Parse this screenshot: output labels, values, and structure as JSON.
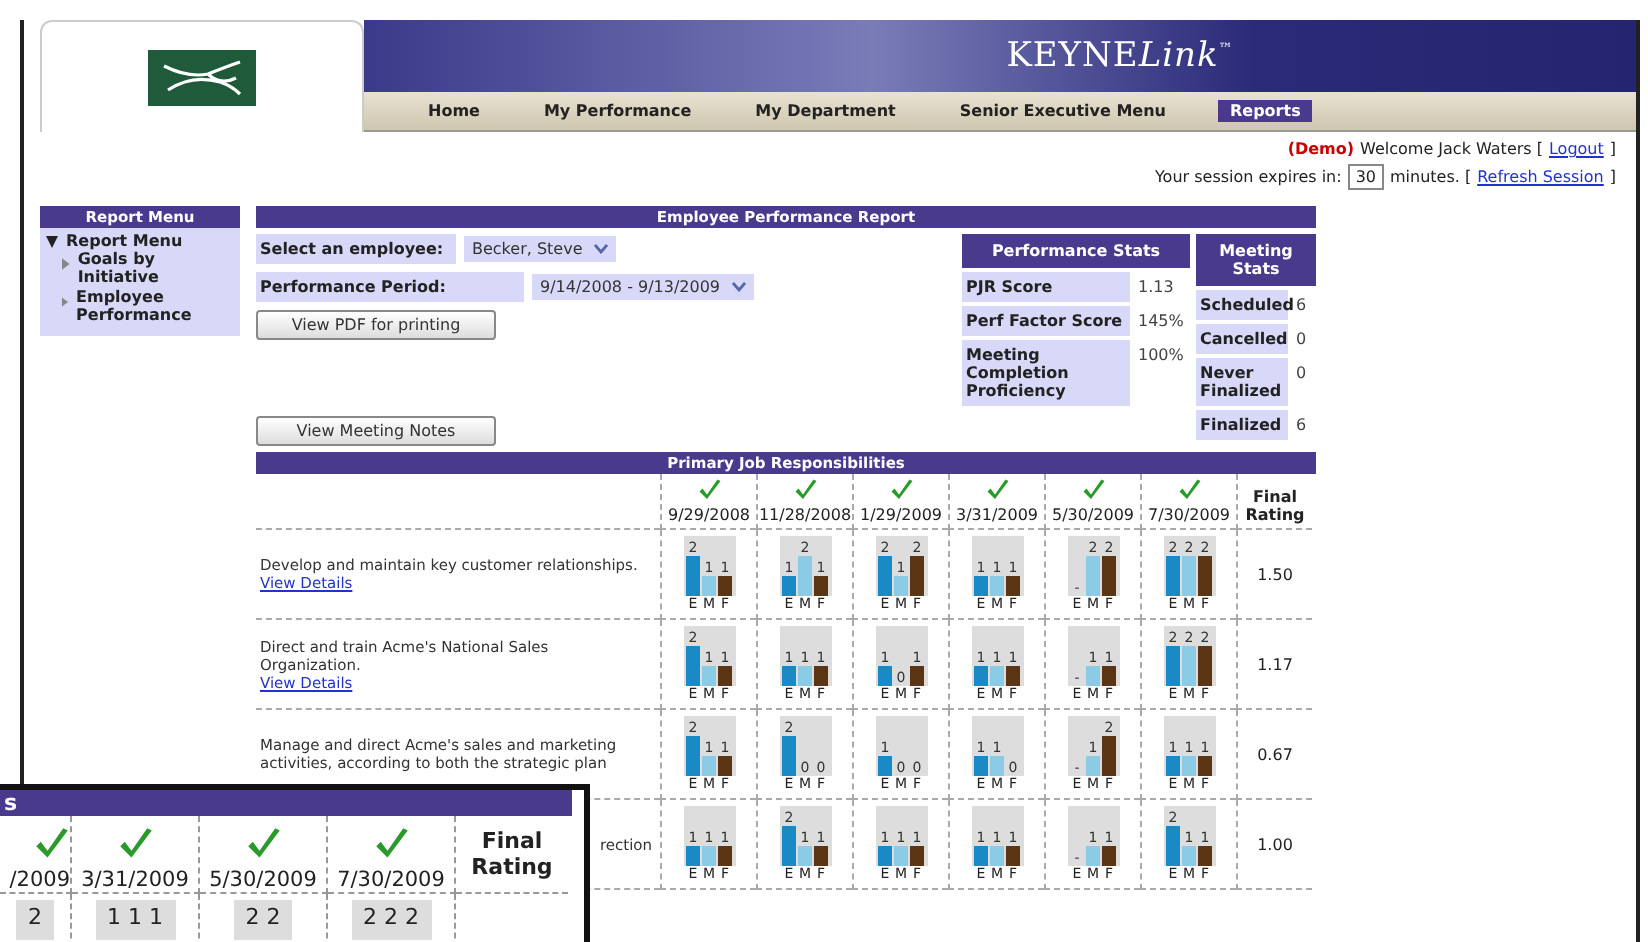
{
  "brand": {
    "name": "KEYNE",
    "italic": "Link",
    "mark": "™"
  },
  "nav": [
    {
      "label": "Home",
      "selected": false
    },
    {
      "label": "My Performance",
      "selected": false
    },
    {
      "label": "My Department",
      "selected": false
    },
    {
      "label": "Senior Executive Menu",
      "selected": false
    },
    {
      "label": "Reports",
      "selected": true
    }
  ],
  "user_bar": {
    "demo": "(Demo)",
    "welcome": "Welcome Jack Waters [",
    "logout": "Logout",
    "logout_close": "]",
    "session_label": "Your session expires in:",
    "session_minutes": "30",
    "session_suffix": "minutes. [",
    "refresh": "Refresh Session",
    "refresh_close": "]"
  },
  "report_menu": {
    "title": "Report Menu",
    "root": {
      "label": "Report Menu",
      "expanded": true,
      "children": [
        {
          "label": "Goals by Initiative"
        },
        {
          "label": "Employee Performance"
        }
      ]
    }
  },
  "report": {
    "title": "Employee Performance Report",
    "employee_label": "Select an employee:",
    "employee_value": "Becker, Steve",
    "period_label": "Performance Period:",
    "period_value": "9/14/2008 - 9/13/2009",
    "pdf_button": "View PDF for printing",
    "notes_button": "View Meeting Notes"
  },
  "performance_stats": {
    "title": "Performance Stats",
    "rows": [
      {
        "label": "PJR Score",
        "value": "1.13"
      },
      {
        "label": "Perf Factor Score",
        "value": "145%"
      },
      {
        "label": "Meeting Completion Proficiency",
        "value": "100%"
      }
    ]
  },
  "meeting_stats": {
    "title": "Meeting Stats",
    "rows": [
      {
        "label": "Scheduled",
        "value": "6"
      },
      {
        "label": "Cancelled",
        "value": "0"
      },
      {
        "label": "Never Finalized",
        "value": "0"
      },
      {
        "label": "Finalized",
        "value": "6"
      }
    ]
  },
  "responsibilities": {
    "title": "Primary Job Responsibilities",
    "final_header": "Final Rating",
    "columns": [
      {
        "date": "9/29/2008",
        "checked": true
      },
      {
        "date": "11/28/2008",
        "checked": true
      },
      {
        "date": "1/29/2009",
        "checked": true
      },
      {
        "date": "3/31/2009",
        "checked": true
      },
      {
        "date": "5/30/2009",
        "checked": true
      },
      {
        "date": "7/30/2009",
        "checked": true
      }
    ],
    "rows": [
      {
        "kind": "full",
        "text": "Develop and maintain key customer relationships.",
        "link": "View Details",
        "rating": "1.50",
        "cells": [
          [
            [
              "E",
              "2"
            ],
            [
              "M",
              "1"
            ],
            [
              "F",
              "1"
            ]
          ],
          [
            [
              "E",
              "1"
            ],
            [
              "M",
              "2"
            ],
            [
              "F",
              "1"
            ]
          ],
          [
            [
              "E",
              "2"
            ],
            [
              "M",
              "1"
            ],
            [
              "F",
              "2"
            ]
          ],
          [
            [
              "E",
              "1"
            ],
            [
              "M",
              "1"
            ],
            [
              "F",
              "1"
            ]
          ],
          [
            [
              "E",
              "-"
            ],
            [
              "M",
              "2"
            ],
            [
              "F",
              "2"
            ]
          ],
          [
            [
              "E",
              "2"
            ],
            [
              "M",
              "2"
            ],
            [
              "F",
              "2"
            ]
          ]
        ]
      },
      {
        "kind": "full",
        "text": "Direct and train Acme's National Sales Organization.",
        "link": "View Details",
        "rating": "1.17",
        "cells": [
          [
            [
              "E",
              "2"
            ],
            [
              "M",
              "1"
            ],
            [
              "F",
              "1"
            ]
          ],
          [
            [
              "E",
              "1"
            ],
            [
              "M",
              "1"
            ],
            [
              "F",
              "1"
            ]
          ],
          [
            [
              "E",
              "1"
            ],
            [
              "M",
              "0"
            ],
            [
              "F",
              "1"
            ]
          ],
          [
            [
              "E",
              "1"
            ],
            [
              "M",
              "1"
            ],
            [
              "F",
              "1"
            ]
          ],
          [
            [
              "E",
              "-"
            ],
            [
              "M",
              "1"
            ],
            [
              "F",
              "1"
            ]
          ],
          [
            [
              "E",
              "2"
            ],
            [
              "M",
              "2"
            ],
            [
              "F",
              "2"
            ]
          ]
        ]
      },
      {
        "kind": "full",
        "text": "Manage and direct Acme's sales and marketing activities, according to both the strategic plan",
        "rating": "0.67",
        "cells": [
          [
            [
              "E",
              "2"
            ],
            [
              "M",
              "1"
            ],
            [
              "F",
              "1"
            ]
          ],
          [
            [
              "E",
              "2"
            ],
            [
              "M",
              "0"
            ],
            [
              "F",
              "0"
            ]
          ],
          [
            [
              "E",
              "1"
            ],
            [
              "M",
              "0"
            ],
            [
              "F",
              "0"
            ]
          ],
          [
            [
              "E",
              "1"
            ],
            [
              "M",
              "1"
            ],
            [
              "F",
              "0"
            ]
          ],
          [
            [
              "E",
              "-"
            ],
            [
              "M",
              "1"
            ],
            [
              "F",
              "2"
            ]
          ],
          [
            [
              "E",
              "1"
            ],
            [
              "M",
              "1"
            ],
            [
              "F",
              "1"
            ]
          ]
        ]
      },
      {
        "kind": "cut",
        "text": "rection",
        "rating": "1.00",
        "cells": [
          [
            [
              "E",
              "1"
            ],
            [
              "M",
              "1"
            ],
            [
              "F",
              "1"
            ]
          ],
          [
            [
              "E",
              "2"
            ],
            [
              "M",
              "1"
            ],
            [
              "F",
              "1"
            ]
          ],
          [
            [
              "E",
              "1"
            ],
            [
              "M",
              "1"
            ],
            [
              "F",
              "1"
            ]
          ],
          [
            [
              "E",
              "1"
            ],
            [
              "M",
              "1"
            ],
            [
              "F",
              "1"
            ]
          ],
          [
            [
              "E",
              "-"
            ],
            [
              "M",
              "1"
            ],
            [
              "F",
              "1"
            ]
          ],
          [
            [
              "E",
              "2"
            ],
            [
              "M",
              "1"
            ],
            [
              "F",
              "1"
            ]
          ]
        ]
      }
    ]
  },
  "inset": {
    "title": "s",
    "final_header": "Final Rating",
    "columns": [
      {
        "date": "/2009",
        "checked": true,
        "cell": "2"
      },
      {
        "date": "3/31/2009",
        "checked": true,
        "cell": "1 1 1"
      },
      {
        "date": "5/30/2009",
        "checked": true,
        "cell": "2 2"
      },
      {
        "date": "7/30/2009",
        "checked": true,
        "cell": "2 2 2"
      }
    ]
  }
}
